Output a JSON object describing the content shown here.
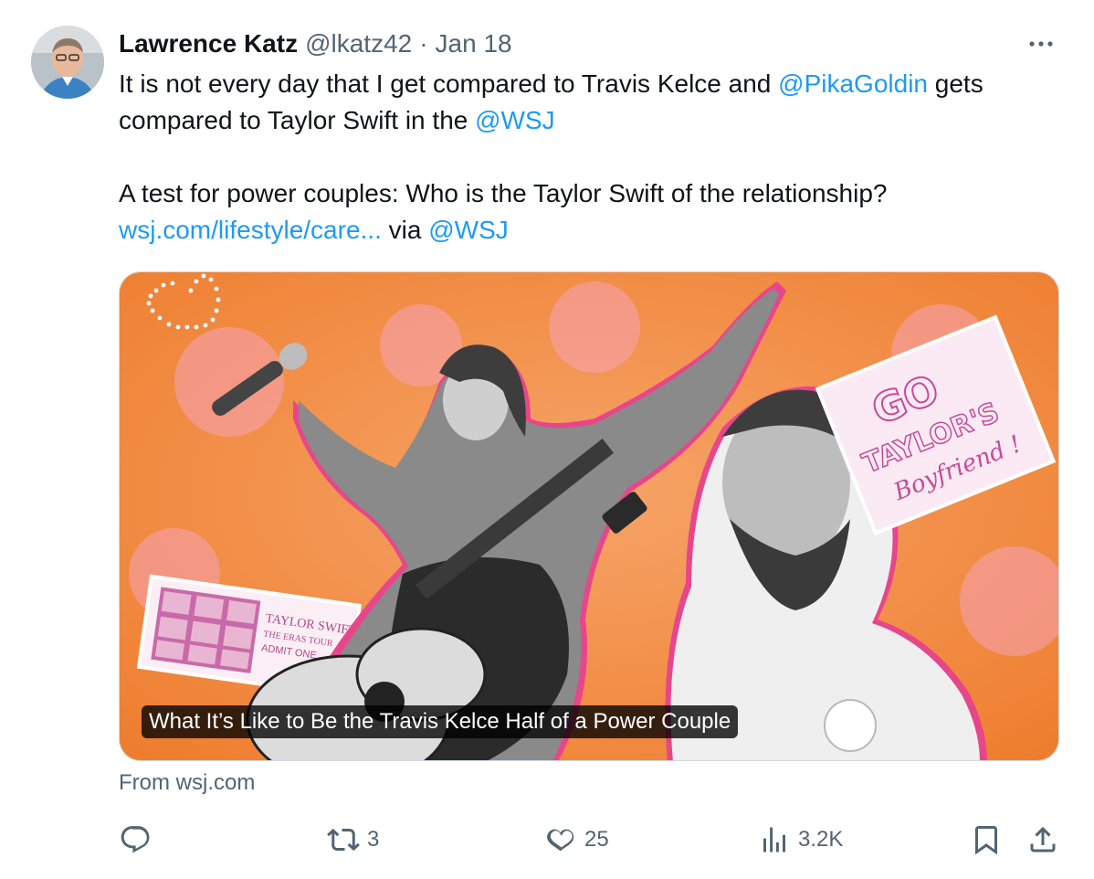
{
  "author": {
    "display_name": "Lawrence Katz",
    "handle": "@lkatz42",
    "separator": "·",
    "date": "Jan 18"
  },
  "tweet": {
    "line1_text": "It is not every day that I get compared to Travis Kelce and ",
    "line1_mention": "@PikaGoldin",
    "line1_tail": " gets",
    "line2_text": "compared to Taylor Swift in the ",
    "line2_mention": "@WSJ",
    "line3_text": "A test for power couples: Who is the Taylor Swift of the relationship?",
    "line4_link": "wsj.com/lifestyle/care...",
    "line4_via": " via ",
    "line4_mention": "@WSJ"
  },
  "card": {
    "headline": "What It’s Like to Be the Travis Kelce Half of a Power Couple",
    "source": "From wsj.com",
    "image_sign_text": [
      "GO",
      "TAYLOR'S",
      "Boyfriend !"
    ],
    "image_ticket_text": [
      "TAYLOR SWIFT",
      "THE ERAS TOUR",
      "ADMIT ONE"
    ],
    "background_color": "#f2883a",
    "accent_color": "#e7468a"
  },
  "actions": {
    "reply": {
      "icon": "reply-icon",
      "count": ""
    },
    "retweet": {
      "icon": "retweet-icon",
      "count": "3"
    },
    "like": {
      "icon": "heart-icon",
      "count": "25"
    },
    "views": {
      "icon": "views-icon",
      "count": "3.2K"
    },
    "bookmark": {
      "icon": "bookmark-icon"
    },
    "share": {
      "icon": "share-icon"
    }
  },
  "colors": {
    "link": "#1d9bf0",
    "secondary_text": "#536471",
    "primary_text": "#0f1419"
  }
}
